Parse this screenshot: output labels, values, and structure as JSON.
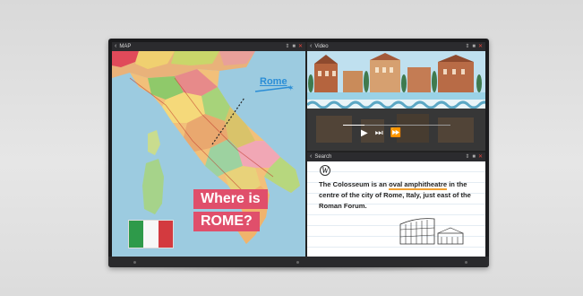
{
  "map_window": {
    "title": "MAP",
    "controls": [
      "⇕",
      "■",
      "✕"
    ],
    "map_label": "Rome",
    "question_lines": [
      "Where is",
      "ROME?"
    ]
  },
  "video_window": {
    "title": "Video",
    "controls": [
      "⇕",
      "■",
      "✕"
    ],
    "playback_progress": 0.2
  },
  "search_window": {
    "title": "Search",
    "controls": [
      "⇕",
      "■",
      "✕"
    ],
    "article_text_before": "The Colosseum is an ",
    "article_highlight": "oval amphitheatre",
    "article_text_after": " in the centre of the city of Rome, Italy, just east of the Roman Forum."
  },
  "colors": {
    "flag_green": "#2e9a4a",
    "flag_white": "#f7f7f7",
    "flag_red": "#d33a3f",
    "question_bg": "#e04f6b",
    "sea": "#9ccbe0"
  }
}
